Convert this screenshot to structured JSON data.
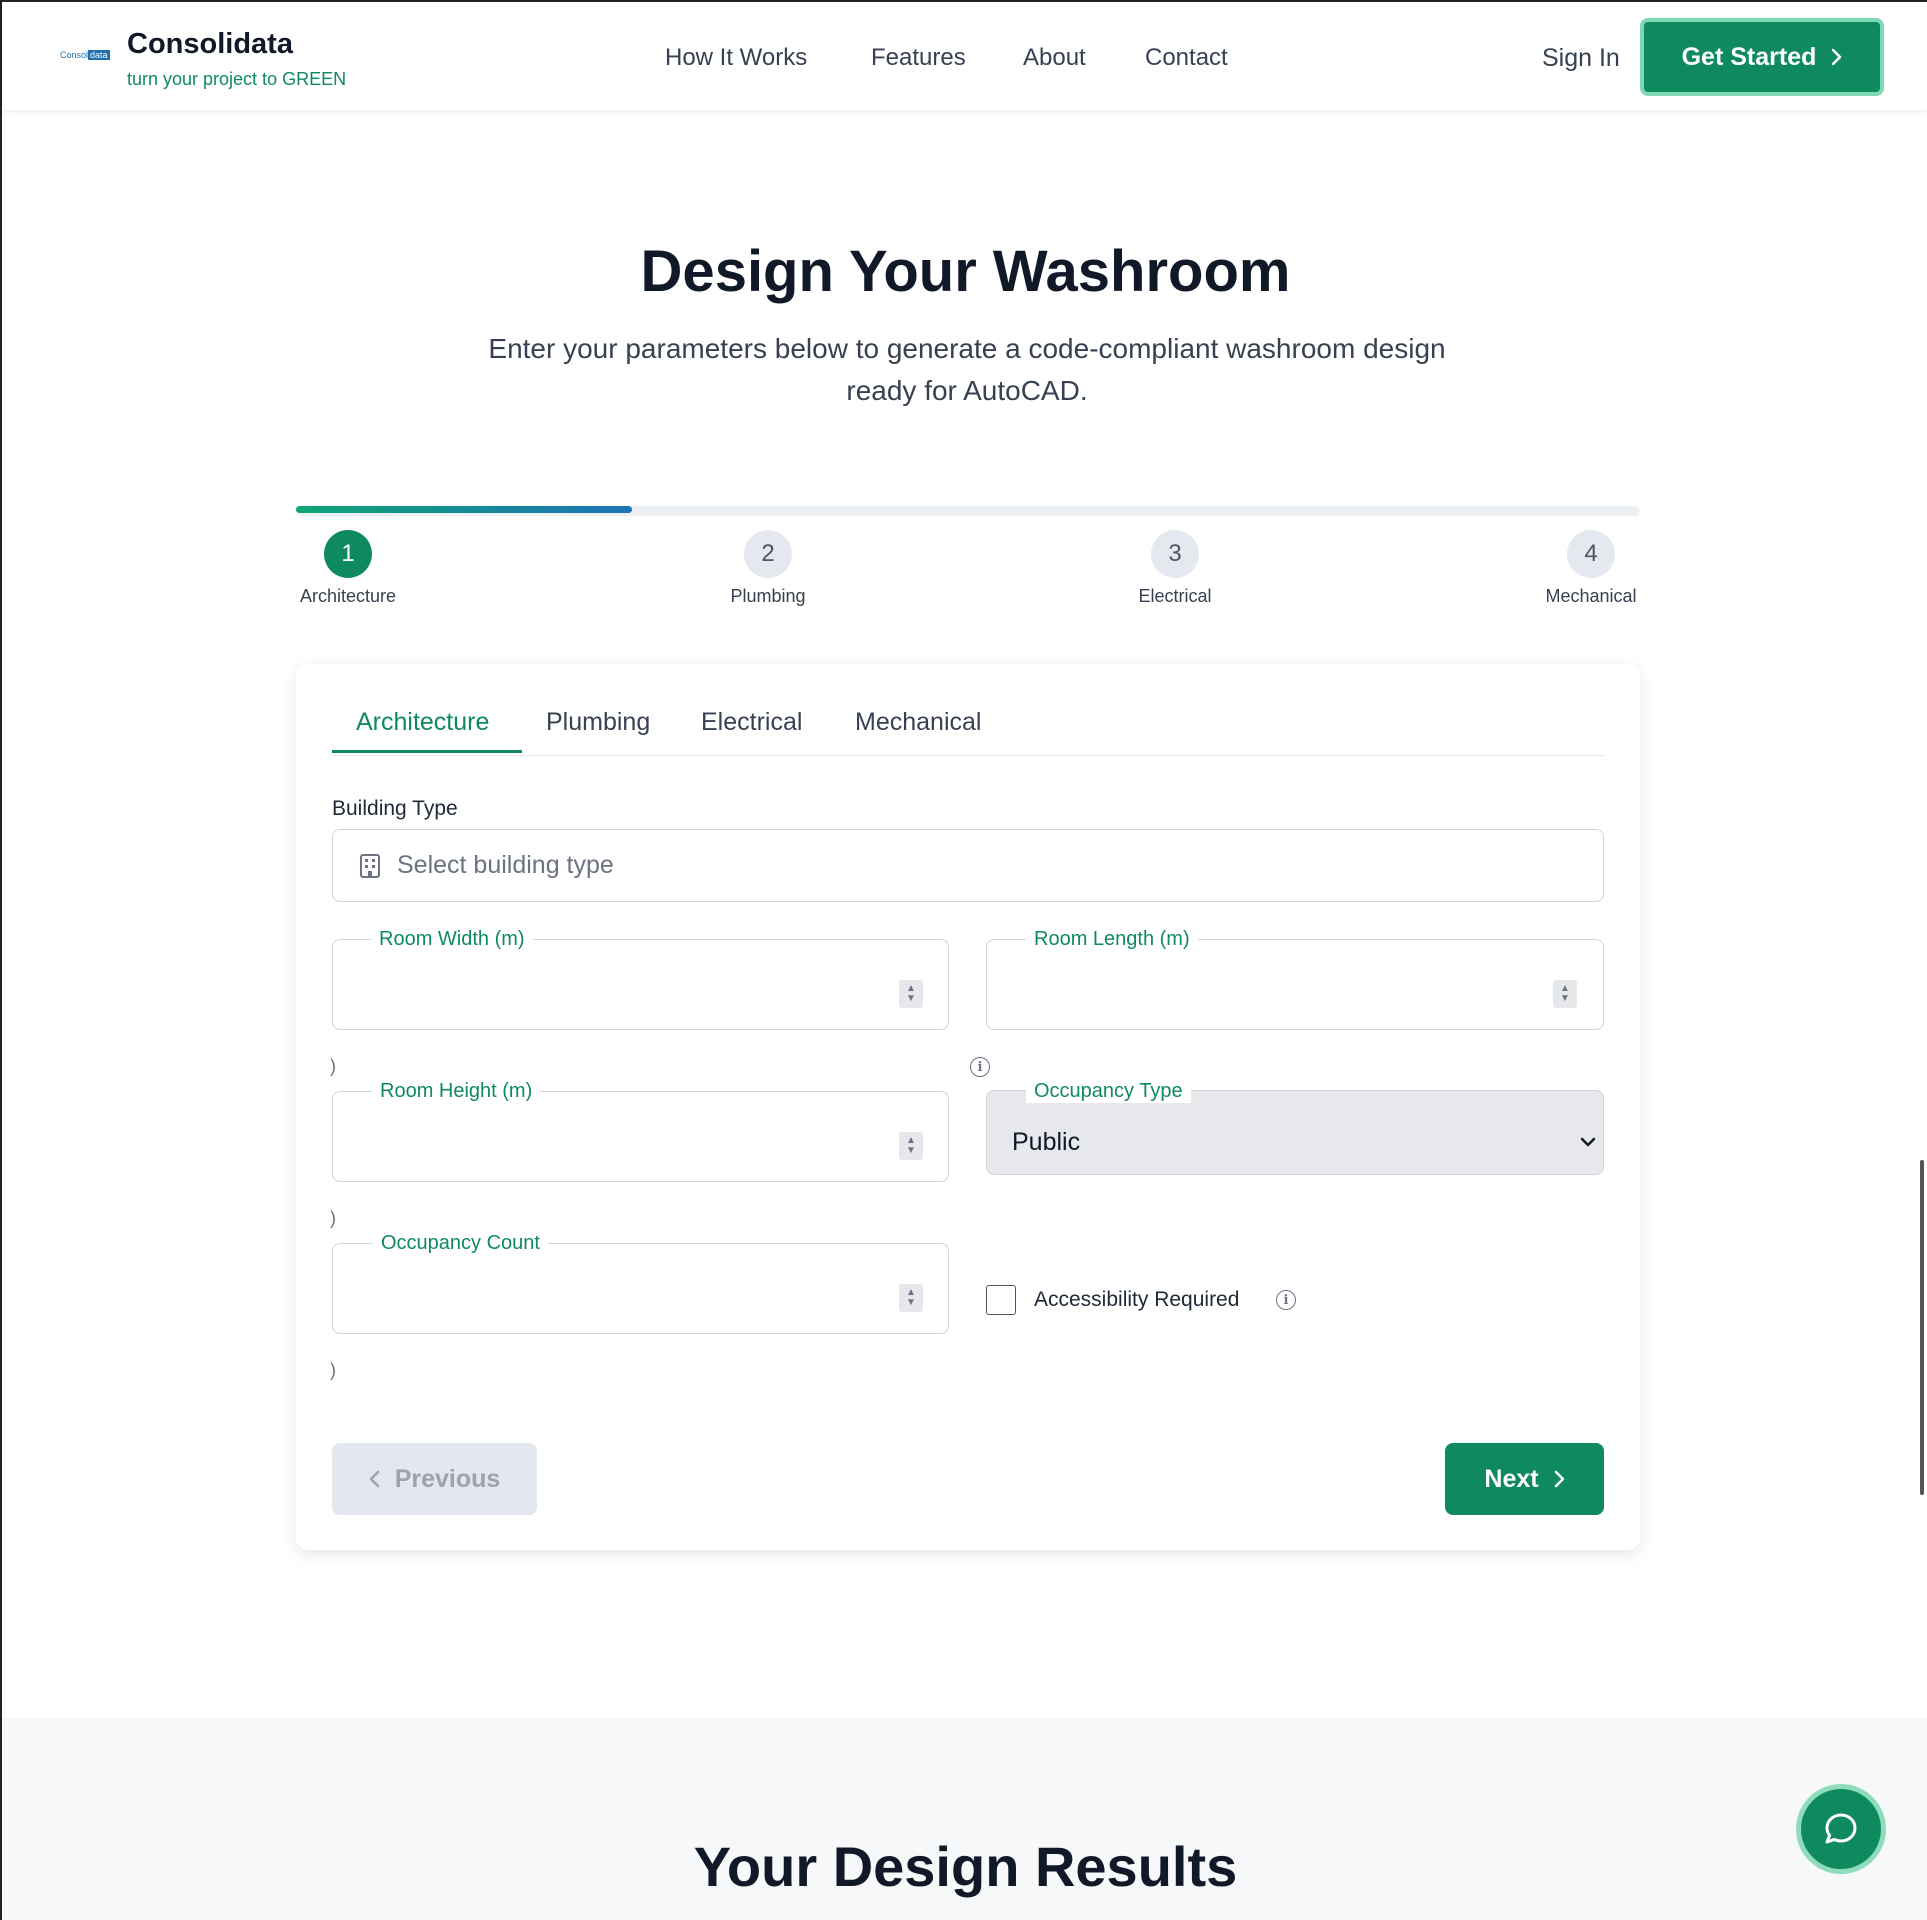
{
  "header": {
    "logo_text_a": "Consol",
    "logo_text_b": "data",
    "brand": "Consolidata",
    "tagline": "turn your project to GREEN",
    "nav": [
      "How It Works",
      "Features",
      "About",
      "Contact"
    ],
    "sign_in": "Sign In",
    "get_started": "Get Started"
  },
  "hero": {
    "title": "Design Your Washroom",
    "subtitle_line1": "Enter your parameters below to generate a code-compliant washroom design",
    "subtitle_line2": "ready for AutoCAD."
  },
  "progress": {
    "value": 0.25,
    "steps": [
      {
        "number": "1",
        "label": "Architecture"
      },
      {
        "number": "2",
        "label": "Plumbing"
      },
      {
        "number": "3",
        "label": "Electrical"
      },
      {
        "number": "4",
        "label": "Mechanical"
      }
    ]
  },
  "tabs": [
    "Architecture",
    "Plumbing",
    "Electrical",
    "Mechanical"
  ],
  "form": {
    "building_type_label": "Building Type",
    "building_type_placeholder": "Select building type",
    "room_width_label": "Room Width (m)",
    "room_length_label": "Room Length (m)",
    "room_height_label": "Room Height (m)",
    "occupancy_type_label": "Occupancy Type",
    "occupancy_type_value": "Public",
    "occupancy_count_label": "Occupancy Count",
    "accessibility_label": "Accessibility Required",
    "paren": ")"
  },
  "buttons": {
    "previous": "Previous",
    "next": "Next"
  },
  "results": {
    "title": "Your Design Results"
  },
  "colors": {
    "brand_green": "#0f8a5f",
    "progress_start": "#0fa574",
    "progress_end": "#1d73b8"
  },
  "icons": {
    "building": "building-icon",
    "info": "info-icon",
    "chat": "chat-icon",
    "chevron_right": "chevron-right-icon",
    "chevron_left": "chevron-left-icon",
    "chevron_down": "chevron-down-icon"
  }
}
